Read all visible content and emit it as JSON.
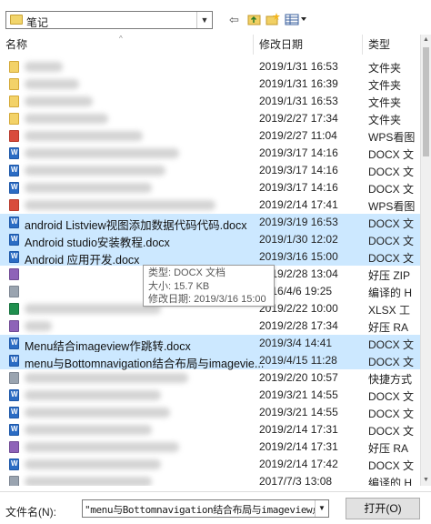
{
  "look_in": {
    "value": "笔记",
    "folder_icon": "folder-icon",
    "dropdown_icon": "dropdown-arrow-icon"
  },
  "toolbar": {
    "back_icon": "back-arrow-icon",
    "up_icon": "up-folder-icon",
    "new_folder_icon": "new-folder-icon",
    "view_icon": "view-menu-icon"
  },
  "columns": {
    "name": "名称",
    "date": "修改日期",
    "type": "类型"
  },
  "rows": [
    {
      "icon": "folder",
      "name": "",
      "date": "2019/1/31 16:53",
      "type": "文件夹",
      "selected": false,
      "blur": 42
    },
    {
      "icon": "folder",
      "name": "",
      "date": "2019/1/31 16:39",
      "type": "文件夹",
      "selected": false,
      "blur": 60
    },
    {
      "icon": "folder",
      "name": "",
      "date": "2019/1/31 16:53",
      "type": "文件夹",
      "selected": false,
      "blur": 75
    },
    {
      "icon": "folder",
      "name": "",
      "date": "2019/2/27 17:34",
      "type": "文件夹",
      "selected": false,
      "blur": 92
    },
    {
      "icon": "wps",
      "name": "",
      "date": "2019/2/27 11:04",
      "type": "WPS看图",
      "selected": false,
      "blur": 130
    },
    {
      "icon": "docx",
      "name": "",
      "date": "2019/3/17 14:16",
      "type": "DOCX 文",
      "selected": false,
      "blur": 170
    },
    {
      "icon": "docx",
      "name": "",
      "date": "2019/3/17 14:16",
      "type": "DOCX 文",
      "selected": false,
      "blur": 155
    },
    {
      "icon": "docx",
      "name": "",
      "date": "2019/3/17 14:16",
      "type": "DOCX 文",
      "selected": false,
      "blur": 140
    },
    {
      "icon": "wps",
      "name": "",
      "date": "2019/2/14 17:41",
      "type": "WPS看图",
      "selected": false,
      "blur": 210
    },
    {
      "icon": "docx",
      "name": "android  Listview视图添加数据代码代码.docx",
      "date": "2019/3/19 16:53",
      "type": "DOCX 文",
      "selected": true,
      "blur": 0
    },
    {
      "icon": "docx",
      "name": "Android studio安装教程.docx",
      "date": "2019/1/30 12:02",
      "type": "DOCX 文",
      "selected": true,
      "blur": 0
    },
    {
      "icon": "docx",
      "name": "Android 应用开发.docx",
      "date": "2019/3/16 15:00",
      "type": "DOCX 文",
      "selected": true,
      "blur": 0
    },
    {
      "icon": "rar",
      "name": "",
      "date": "2019/2/28 13:04",
      "type": "好压 ZIP",
      "selected": false,
      "blur": 0
    },
    {
      "icon": "exe",
      "name": "",
      "date": "2016/4/6 19:25",
      "type": "编译的 H",
      "selected": false,
      "blur": 0
    },
    {
      "icon": "xlsx",
      "name": "",
      "date": "2019/2/22 10:00",
      "type": "XLSX 工",
      "selected": false,
      "blur": 150
    },
    {
      "icon": "rar",
      "name": "",
      "date": "2019/2/28 17:34",
      "type": "好压 RA",
      "selected": false,
      "blur": 30
    },
    {
      "icon": "docx",
      "name": "Menu结合imageview作跳转.docx",
      "date": "2019/3/4 14:41",
      "type": "DOCX 文",
      "selected": true,
      "blur": 0
    },
    {
      "icon": "docx",
      "name": "menu与Bottomnavigation结合布局与imagevie...",
      "date": "2019/4/15 11:28",
      "type": "DOCX 文",
      "selected": true,
      "blur": 0
    },
    {
      "icon": "exe",
      "name": "",
      "date": "2019/2/20 10:57",
      "type": "快捷方式",
      "selected": false,
      "blur": 180
    },
    {
      "icon": "docx",
      "name": "",
      "date": "2019/3/21 14:55",
      "type": "DOCX 文",
      "selected": false,
      "blur": 150
    },
    {
      "icon": "docx",
      "name": "",
      "date": "2019/3/21 14:55",
      "type": "DOCX 文",
      "selected": false,
      "blur": 160
    },
    {
      "icon": "docx",
      "name": "",
      "date": "2019/2/14 17:31",
      "type": "DOCX 文",
      "selected": false,
      "blur": 140
    },
    {
      "icon": "rar",
      "name": "",
      "date": "2019/2/14 17:31",
      "type": "好压 RA",
      "selected": false,
      "blur": 170
    },
    {
      "icon": "docx",
      "name": "",
      "date": "2019/2/14 17:42",
      "type": "DOCX 文",
      "selected": false,
      "blur": 150
    },
    {
      "icon": "exe",
      "name": "",
      "date": "2017/7/3 13:08",
      "type": "编译的 H",
      "selected": false,
      "blur": 140
    }
  ],
  "tooltip": {
    "type_line": "类型: DOCX 文档",
    "size_line": "大小: 15.7 KB",
    "date_line": "修改日期: 2019/3/16 15:00"
  },
  "filename": {
    "label": "文件名(N):",
    "value": "\"menu与Bottomnavigation结合布局与imageview点击跳转",
    "dropdown_icon": "dropdown-arrow-icon"
  },
  "open_button": "打开(O)"
}
